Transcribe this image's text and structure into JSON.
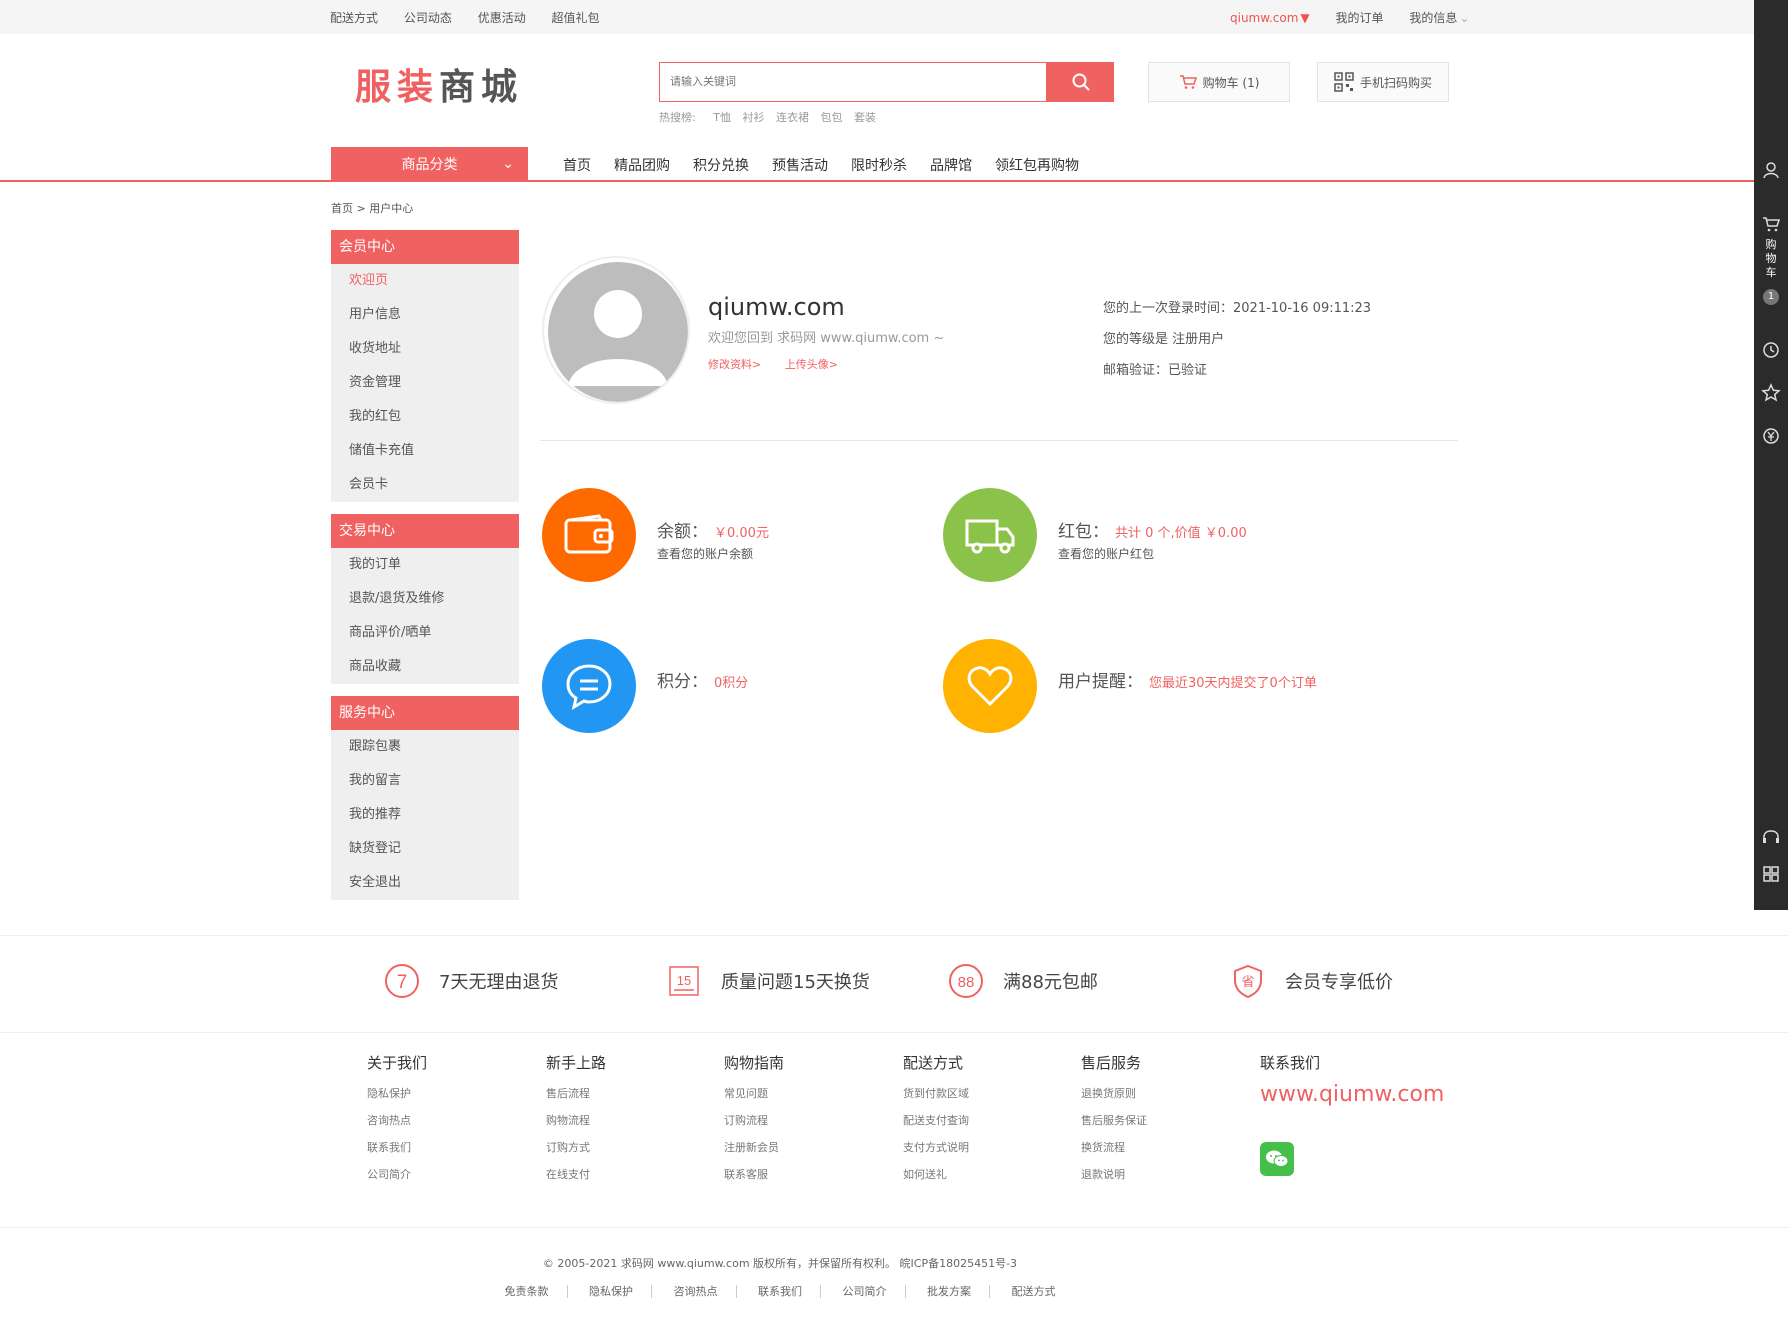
{
  "topbar": {
    "links": [
      "配送方式",
      "公司动态",
      "优惠活动",
      "超值礼包"
    ],
    "site": "qiumw.com",
    "orders": "我的订单",
    "myinfo": "我的信息"
  },
  "logo": {
    "part1": "服装",
    "part2": "商城"
  },
  "search": {
    "placeholder": "请输入关键词",
    "hot_label": "热搜榜:",
    "hot_items": [
      "T恤",
      "衬衫",
      "连衣裙",
      "包包",
      "套装"
    ]
  },
  "cart": {
    "label": "购物车 (1)"
  },
  "qr": {
    "label": "手机扫码购买"
  },
  "nav": {
    "category": "商品分类",
    "items": [
      "首页",
      "精品团购",
      "积分兑换",
      "预售活动",
      "限时秒杀",
      "品牌馆",
      "领红包再购物"
    ]
  },
  "breadcrumb": "首页 > 用户中心",
  "sidebar": {
    "groups": [
      {
        "title": "会员中心",
        "items": [
          "欢迎页",
          "用户信息",
          "收货地址",
          "资金管理",
          "我的红包",
          "储值卡充值",
          "会员卡"
        ]
      },
      {
        "title": "交易中心",
        "items": [
          "我的订单",
          "退款/退货及维修",
          "商品评价/晒单",
          "商品收藏"
        ]
      },
      {
        "title": "服务中心",
        "items": [
          "跟踪包裹",
          "我的留言",
          "我的推荐",
          "缺货登记",
          "安全退出"
        ]
      }
    ]
  },
  "profile": {
    "username": "qiumw.com",
    "welcome": "欢迎您回到 求码网 www.qiumw.com ~",
    "edit": "修改资料>",
    "upload": "上传头像>",
    "last_login": "您的上一次登录时间：2021-10-16 09:11:23",
    "level": "您的等级是 注册用户",
    "email": "邮箱验证：已验证"
  },
  "stats": {
    "balance": {
      "label": "余额：",
      "value": "￥0.00元",
      "sub": "查看您的账户余额"
    },
    "redpacket": {
      "label": "红包：",
      "value": "共计 0 个,价值 ￥0.00",
      "sub": "查看您的账户红包"
    },
    "points": {
      "label": "积分：",
      "value": "0积分"
    },
    "reminder": {
      "label": "用户提醒：",
      "value": "您最近30天内提交了0个订单"
    }
  },
  "services": [
    "7天无理由退货",
    "质量问题15天换货",
    "满88元包邮",
    "会员专享低价"
  ],
  "service_icon_text": [
    "7",
    "15",
    "88",
    "省"
  ],
  "footer": {
    "cols": [
      {
        "title": "关于我们",
        "items": [
          "隐私保护",
          "咨询热点",
          "联系我们",
          "公司简介"
        ]
      },
      {
        "title": "新手上路",
        "items": [
          "售后流程",
          "购物流程",
          "订购方式",
          "在线支付"
        ]
      },
      {
        "title": "购物指南",
        "items": [
          "常见问题",
          "订购流程",
          "注册新会员",
          "联系客服"
        ]
      },
      {
        "title": "配送方式",
        "items": [
          "货到付款区域",
          "配送支付查询",
          "支付方式说明",
          "如何送礼"
        ]
      },
      {
        "title": "售后服务",
        "items": [
          "退换货原则",
          "售后服务保证",
          "换货流程",
          "退款说明"
        ]
      }
    ],
    "contact_title": "联系我们",
    "contact_site": "www.qiumw.com",
    "copyright": "© 2005-2021 求码网 www.qiumw.com 版权所有，并保留所有权利。 皖ICP备18025451号-3",
    "links": [
      "免责条款",
      "隐私保护",
      "咨询热点",
      "联系我们",
      "公司简介",
      "批发方案",
      "配送方式"
    ]
  },
  "rail": {
    "cart_text": "购物车",
    "cart_count": "1"
  },
  "colors": {
    "accent": "#f06262",
    "orange": "#ff6a00",
    "green": "#8bc34a",
    "blue": "#2196f3",
    "yellow": "#ffb300"
  },
  "icons": [
    "search-icon",
    "cart-icon",
    "qr-icon",
    "user-icon",
    "history-icon",
    "star-icon",
    "coupon-icon",
    "headset-icon",
    "grid-icon",
    "wallet-icon",
    "truck-icon",
    "chat-icon",
    "heart-icon",
    "wechat-icon"
  ]
}
